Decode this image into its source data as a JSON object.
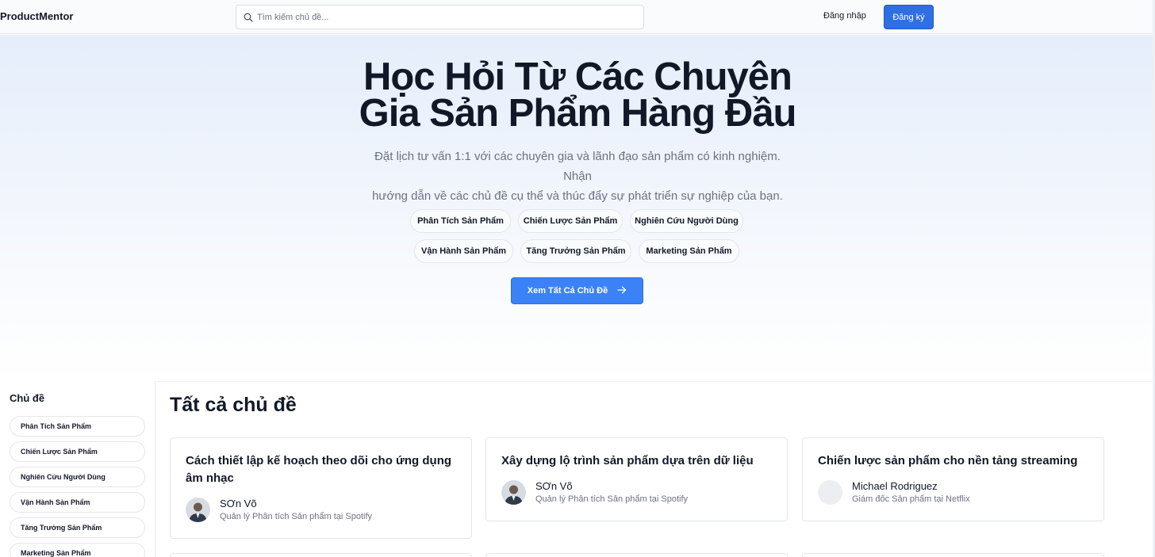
{
  "header": {
    "brand": "ProductMentor",
    "search_placeholder": "Tìm kiếm chủ đề...",
    "login_label": "Đăng nhập",
    "signup_label": "Đăng ký"
  },
  "hero": {
    "title_line1": "Học Hỏi Từ Các Chuyên",
    "title_line2": "Gia Sản Phẩm Hàng Đầu",
    "subtitle_line1": "Đặt lịch tư vấn 1:1 với các chuyên gia và lãnh đạo sản phẩm có kinh nghiệm. Nhận",
    "subtitle_line2": "hướng dẫn về các chủ đề cụ thể và thúc đẩy sự phát triển sự nghiệp của bạn.",
    "chips": [
      "Phân Tích Sản Phẩm",
      "Chiến Lược Sản Phẩm",
      "Nghiên Cứu Người Dùng",
      "Vận Hành Sản Phẩm",
      "Tăng Trưởng Sản Phẩm",
      "Marketing Sản Phẩm"
    ],
    "cta_label": "Xem Tất Cả Chủ Đề"
  },
  "sidebar": {
    "title": "Chủ đề",
    "items": [
      "Phân Tích Sản Phẩm",
      "Chiến Lược Sản Phẩm",
      "Nghiên Cứu Người Dùng",
      "Vận Hành Sản Phẩm",
      "Tăng Trưởng Sản Phẩm",
      "Marketing Sản Phẩm"
    ]
  },
  "main": {
    "title": "Tất cả chủ đề",
    "cards": [
      {
        "title": "Cách thiết lập kế hoạch theo dõi cho ứng dụng âm nhạc",
        "author": "SƠn Võ",
        "role": "Quản lý Phân tích Sản phẩm tại Spotify",
        "avatar": "photo"
      },
      {
        "title": "Xây dựng lộ trình sản phẩm dựa trên dữ liệu",
        "author": "SƠn Võ",
        "role": "Quản lý Phân tích Sản phẩm tại Spotify",
        "avatar": "photo"
      },
      {
        "title": "Chiến lược sản phẩm cho nền tảng streaming",
        "author": "Michael Rodriguez",
        "role": "Giám đốc Sản phẩm tại Netflix",
        "avatar": "placeholder"
      }
    ]
  },
  "colors": {
    "accent": "#3b82f6",
    "signup_bg": "#2f6fe4",
    "text": "#111827",
    "muted": "#6b7280"
  },
  "icons": {
    "search": "search-icon",
    "cta_arrow": "arrow-right-icon"
  }
}
